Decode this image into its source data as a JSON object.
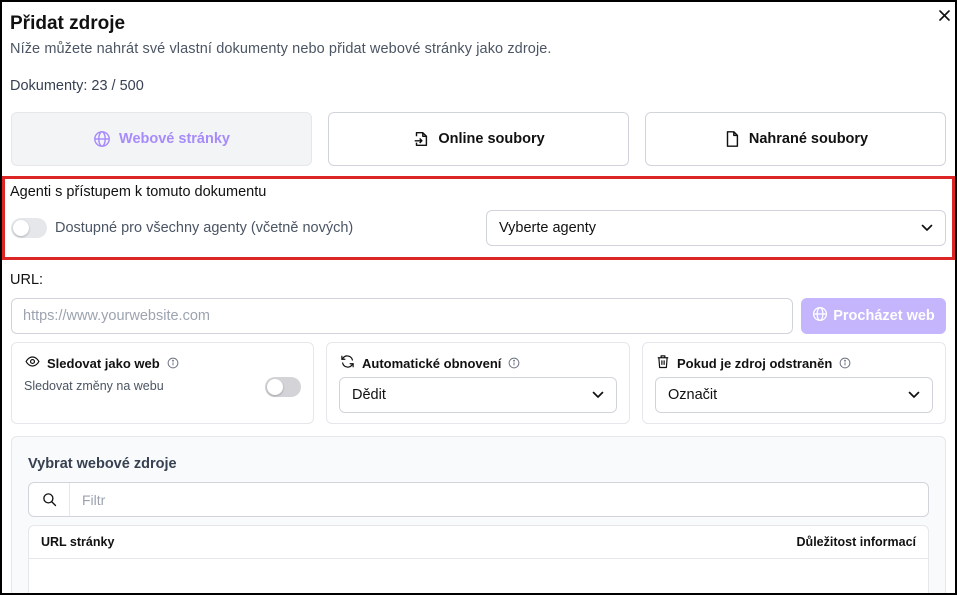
{
  "dialog": {
    "title": "Přidat zdroje",
    "subtitle": "Níže můžete nahrát své vlastní dokumenty nebo přidat webové stránky jako zdroje.",
    "documents_count": "Dokumenty: 23 / 500",
    "close_icon": "close-icon"
  },
  "tabs": [
    {
      "label": "Webové stránky",
      "icon": "globe-icon",
      "active": true
    },
    {
      "label": "Online soubory",
      "icon": "file-import-icon",
      "active": false
    },
    {
      "label": "Nahrané soubory",
      "icon": "file-icon",
      "active": false
    }
  ],
  "agents": {
    "label": "Agenti s přístupem k tomuto dokumentu",
    "toggle_label": "Dostupné pro všechny agenty (včetně nových)",
    "toggle_on": false,
    "select_value": "Vyberte agenty"
  },
  "url": {
    "label": "URL:",
    "placeholder": "https://www.yourwebsite.com",
    "browse_label": "Procházet web"
  },
  "cards": {
    "watch": {
      "title": "Sledovat jako web",
      "sub": "Sledovat změny na webu",
      "toggle_on": false
    },
    "refresh": {
      "title": "Automatické obnovení",
      "value": "Dědit"
    },
    "removed": {
      "title": "Pokud je zdroj odstraněn",
      "value": "Označit"
    }
  },
  "web_sources": {
    "title": "Vybrat webové zdroje",
    "filter_placeholder": "Filtr",
    "columns": [
      "URL stránky",
      "Důležitost informací"
    ]
  },
  "colors": {
    "accent": "#a78bfa",
    "button_disabled": "#c4b5fd",
    "highlight_border": "#dc2626"
  }
}
